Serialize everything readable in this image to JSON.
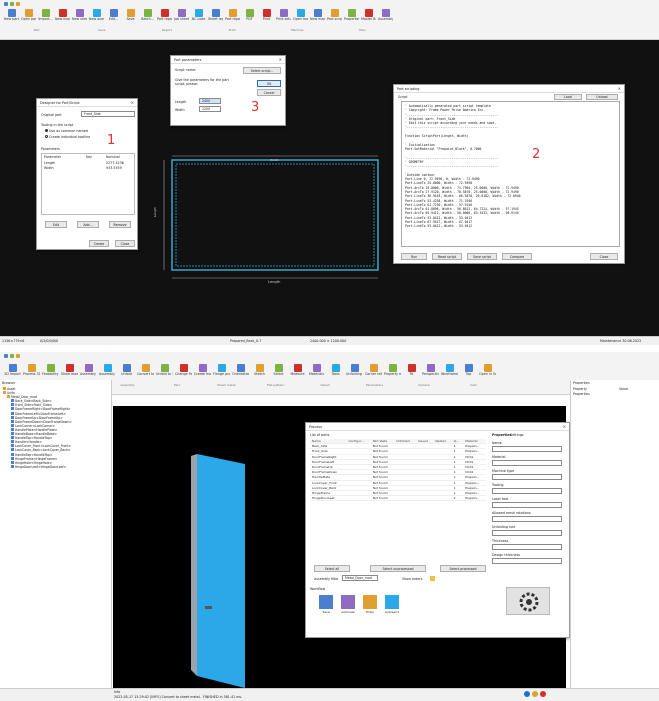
{
  "top": {
    "ribbon_buttons": [
      "New part...",
      "Open part...",
      "Import...",
      "New mod...",
      "New sheet...",
      "New asm...",
      "Edit...",
      "Save",
      "Batch...",
      "Part report",
      "Job sheet",
      "NC code",
      "Sheet report",
      "Part report",
      "PDF",
      "Print",
      "Print setup...",
      "Open machine...",
      "New machine...",
      "Part scripting...",
      "Properties...",
      "Master BendCam",
      "Assembly files..."
    ],
    "ribbon_groups": [
      "Part",
      "Save",
      "Report",
      "Print",
      "Machine",
      "Misc"
    ],
    "statusbar": {
      "left1": "1156×779×6",
      "left2": "0/2/0/0/0/0",
      "center": "Prepared_Back_0.7",
      "center2": "2400.000 × 1200.000",
      "right": "Maintenance 30.06.2023"
    },
    "viewport": {
      "dim_length": "Length",
      "dim_width": "Width",
      "dim_label": "Length"
    },
    "wizard": {
      "title": "Designer for Part/Script",
      "original_part_label": "Original part",
      "original_part_value": "Front_Side",
      "tooling_label": "Tooling in the script",
      "radio_1": "Use as common named",
      "radio_2": "Create individual toolline",
      "params_label": "Parameters",
      "col_param": "Parameter",
      "col_key": "Key",
      "col_nominal": "Nominal",
      "rows": [
        [
          "Length",
          "",
          "2277.4236"
        ],
        [
          "Width",
          "",
          "933.5559"
        ]
      ],
      "btn_edit": "Edit",
      "btn_add": "Add...",
      "btn_remove": "Remove",
      "btn_create": "Create",
      "btn_close": "Close",
      "marker": "1"
    },
    "params_dialog": {
      "title": "Part parameters",
      "script_name_label": "Script name:",
      "browse": "Select script...",
      "prompt": "Give the parameters for the part script, please:",
      "ok": "OK",
      "cancel": "Cancel",
      "length_label": "Length",
      "length_value": "2400",
      "width_label": "Width",
      "width_value": "1200",
      "marker": "3"
    },
    "script_dialog": {
      "title": "Part scripting",
      "script_label": "Script",
      "tab_load": "Load",
      "tab_save": "Unload",
      "lines": [
        "' Automatically generated part script template",
        "' Copyright: Frame Power Pulse America Inc.",
        "'-------------------------------------------------",
        "' Original part: Front_Side",
        "' Edit this script according your needs and save.",
        "'-------------------------------------------------",
        "",
        "Function ScriptPart(Length, Width)",
        "",
        "' Initialization",
        "Part.SetMaterial \"Prepaint_Black\", 0.7000",
        "",
        "'-------------------------------------------------",
        "' GEOMETRY",
        "'-------------------------------------------------",
        "",
        "'Outside contour",
        "Part.Line 0, 72.9490, 0, Width - 72.9490",
        "Part.LineTo 25.0000, Width - 72.9490",
        "Part.ArcTo 25.0000, Width - 71.7904, 25.0000, Width - 72.9490",
        "Part.ArcTo 27.9120, Width - 70.5870, 25.0000, Width - 72.9490",
        "Part.LineTo 36.9163, Width - 66.5870, 26.0182, Width - 72.0940",
        "Part.LineTo 53.4238, Width - 71.1946",
        "Part.LineTo 61.7230, Width - 57.9146",
        "Part.ArcTo 61.8096, Width - 56.8612, 64.7224, Width - 57.1945",
        "Part.ArcTo 65.9412, Width - 58.0000, 63.3413, Width - 58.9145",
        "Part.LineTo 53.0412, Width - 53.0412",
        "Part.LineTo 67.9417, Width - 67.0417",
        "Part.LineTo 53.0412, Width - 53.0412"
      ],
      "btn_run": "Run",
      "btn_readmore": "Read script",
      "btn_save": "Save script",
      "btn_compare": "Compare",
      "btn_close": "Close",
      "marker": "2"
    }
  },
  "bottom": {
    "ribbon_buttons": [
      "3D Import",
      "Process 3D",
      "Feasibility study",
      "Show assembly",
      "Assembly file",
      "Assembly filter",
      "Unfold",
      "Convert to sheet metal",
      "Unfold to 3D",
      "Change flat side",
      "Create from bend reliefs",
      "Flange profile",
      "Orientation",
      "Sketch",
      "Select",
      "Measure",
      "Materials",
      "Tools",
      "Unfolding rules",
      "Corner relief",
      "Property mapping",
      "Fit",
      "Perspective",
      "Wireframe",
      "Top",
      "Open in Solid Edge"
    ],
    "ribbon_groups": [
      "3D",
      "Process",
      "Assembly",
      "Part",
      "Sheet metal",
      "Flat pattern",
      "Select",
      "Parameters",
      "Camera",
      "CAD"
    ],
    "browser_title": "Browser",
    "tree": [
      "Asset",
      "Units",
      "Metal_Door_mod",
      "Back_Side<Back_Side>",
      "Front_Side<Front_Side>",
      "DoorFrameRight<DoorFrameRight>",
      "DoorFrameLeft<DoorFrameLeft>",
      "DoorFrameUp<DoorFrameUp>",
      "DoorFrameDown<DoorFrameDown>",
      "LockCorner<LockCorner>",
      "HandlePlate<HandlePlate>",
      "HandleBase<HandleBase>",
      "HandleTop<HandleTop>",
      "Handle<Handle>",
      "LockCover_Front<LockCover_Front>",
      "LockCover_Back<LockCover_Back>",
      "HandleTap<HandleTap>",
      "HingeFrame<HingeFrame>",
      "HingeHole<HingeHole>",
      "HingeDoorLeaf<HingeDoorLeaf>"
    ],
    "process": {
      "title": "Process",
      "list_label": "List of parts",
      "cols": [
        "Name",
        "Configur...",
        "Part state",
        "Unfolded",
        "Issued",
        "Nested",
        "Q...",
        "Material"
      ],
      "rows": [
        [
          "Back_Side",
          "",
          "Not found",
          "",
          "",
          "",
          "1",
          "Prepain..."
        ],
        [
          "Front_Side",
          "",
          "Not found",
          "",
          "",
          "",
          "1",
          "Prepain..."
        ],
        [
          "DoorFrameRight",
          "",
          "Not found",
          "",
          "",
          "",
          "1",
          "DC01"
        ],
        [
          "DoorFrameLeft",
          "",
          "Not found",
          "",
          "",
          "",
          "1",
          "DC01"
        ],
        [
          "DoorFrameUp",
          "",
          "Not found",
          "",
          "",
          "",
          "1",
          "DC01"
        ],
        [
          "DoorFrameDown",
          "",
          "Not found",
          "",
          "",
          "",
          "1",
          "DC01"
        ],
        [
          "HandlePlate",
          "",
          "Not found",
          "",
          "",
          "",
          "1",
          "Prepain..."
        ],
        [
          "LockCover_Front",
          "",
          "Not found",
          "",
          "",
          "",
          "1",
          "Prepain..."
        ],
        [
          "LockCover_Back",
          "",
          "Not found",
          "",
          "",
          "",
          "1",
          "Prepain..."
        ],
        [
          "HingeFrame",
          "",
          "Not found",
          "",
          "",
          "",
          "1",
          "Prepain..."
        ],
        [
          "HingeDoorLeaf",
          "",
          "Not found",
          "",
          "",
          "",
          "2",
          "Prepain..."
        ]
      ],
      "select_all": "Select all",
      "select_unprocessed": "Select unprocessed",
      "select_processed": "Select processed",
      "filter_label": "Assembly filter",
      "filter_value": "Metal_Door_mod",
      "show_orders": "Show orders",
      "workflow_label": "Workflow",
      "workflow_items": [
        "Save",
        "Autonest",
        "Order",
        "Autosend"
      ],
      "props_tab1": "Properties",
      "props_tab2": "Settings",
      "prop_fields": [
        "Name",
        "Material",
        "Machine type",
        "Tooling",
        "Laser tool",
        "Allowed mesh rotations",
        "Unfolding rule",
        "Thickness",
        "Design thickness"
      ]
    },
    "right_panel": {
      "title": "Properties",
      "col1": "Property",
      "col2": "Value",
      "row": "Properties"
    },
    "statusbar_line1": "Info",
    "statusbar_line2": "2023-05-17 13:29:02 [INFO] Convert to sheet metal - FINISHED in 581.41 ms."
  },
  "colors": {
    "red_marker": "#e0322c",
    "door_blue": "#2aa8e8",
    "accent": "#1e6fd0"
  }
}
